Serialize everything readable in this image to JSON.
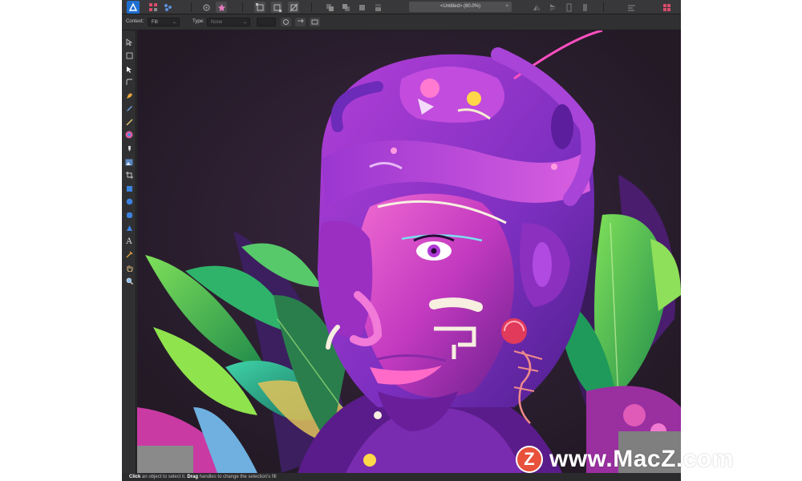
{
  "document_tab": {
    "title": "<Untitled> (80.0%)",
    "close": "×"
  },
  "context_toolbar": {
    "context_label": "Context:",
    "context_value": "Fill",
    "type_label": "Type:",
    "type_value": "None"
  },
  "tools": [
    "move-tool",
    "artboard-tool",
    "node-tool",
    "corner-tool",
    "pen-tool",
    "pencil-tool",
    "vector-brush-tool",
    "fill-tool",
    "transparency-tool",
    "place-image-tool",
    "crop-tool",
    "rectangle-tool",
    "ellipse-tool",
    "rounded-rectangle-tool",
    "triangle-tool",
    "text-tool",
    "color-picker-tool",
    "hand-tool",
    "zoom-tool"
  ],
  "status": {
    "click_word": "Click",
    "click_text": " an object to select it. ",
    "drag_word": "Drag",
    "drag_text": " handles to change the selection's fill"
  },
  "watermark": {
    "badge": "Z",
    "text": "www.MacZ.com"
  },
  "colors": {
    "toolbar": "#38383a",
    "canvas_bg": "#2f2233",
    "accent_magenta": "#d93fd1",
    "watermark_badge": "#e8513b"
  }
}
